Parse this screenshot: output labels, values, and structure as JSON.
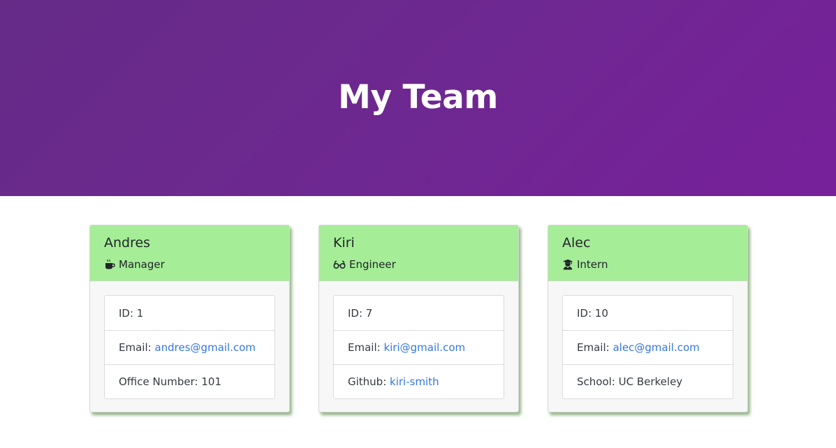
{
  "header": {
    "title": "My Team"
  },
  "team": [
    {
      "name": "Andres",
      "role": "Manager",
      "role_icon": "coffee-icon",
      "id_label": "ID: ",
      "id": "1",
      "email_label": "Email: ",
      "email": "andres@gmail.com",
      "extra_label": "Office Number: ",
      "extra_value": "101"
    },
    {
      "name": "Kiri",
      "role": "Engineer",
      "role_icon": "glasses-icon",
      "id_label": "ID: ",
      "id": "7",
      "email_label": "Email: ",
      "email": "kiri@gmail.com",
      "extra_label": "Github: ",
      "extra_value": "kiri-smith"
    },
    {
      "name": "Alec",
      "role": "Intern",
      "role_icon": "graduate-icon",
      "id_label": "ID: ",
      "id": "10",
      "email_label": "Email: ",
      "email": "alec@gmail.com",
      "extra_label": "School: ",
      "extra_value": "UC Berkeley"
    }
  ],
  "colors": {
    "header_gradient_start": "#652b87",
    "header_gradient_end": "#77209a",
    "card_header": "#a6ed98",
    "link": "#3577e0"
  }
}
